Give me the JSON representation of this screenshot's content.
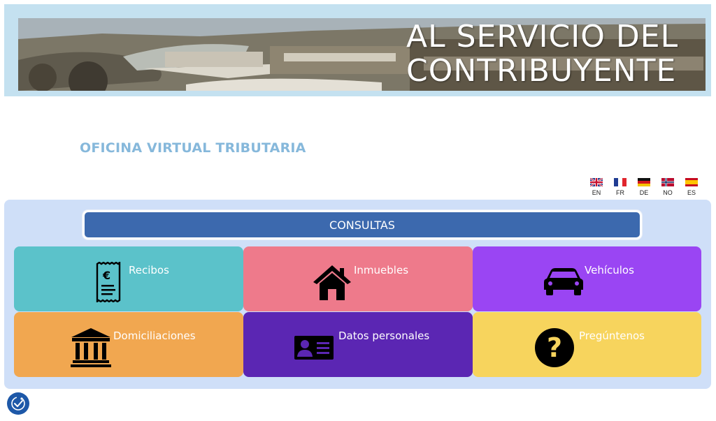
{
  "banner": {
    "title_line1": "AL SERVICIO DEL",
    "title_line2": "CONTRIBUYENTE"
  },
  "office_title": "OFICINA VIRTUAL TRIBUTARIA",
  "languages": [
    {
      "code": "EN",
      "icon": "uk-flag-icon"
    },
    {
      "code": "FR",
      "icon": "france-flag-icon"
    },
    {
      "code": "DE",
      "icon": "germany-flag-icon"
    },
    {
      "code": "NO",
      "icon": "norway-flag-icon"
    },
    {
      "code": "ES",
      "icon": "spain-flag-icon"
    }
  ],
  "panel": {
    "header": "CONSULTAS",
    "tiles": [
      {
        "label": "Recibos",
        "icon": "receipt-euro-icon",
        "color": "#5bc2ca"
      },
      {
        "label": "Inmuebles",
        "icon": "house-icon",
        "color": "#ee7a8b"
      },
      {
        "label": "Vehículos",
        "icon": "car-icon",
        "color": "#9a45f3"
      },
      {
        "label": "Domiciliaciones",
        "icon": "bank-icon",
        "color": "#f1a750"
      },
      {
        "label": "Datos personales",
        "icon": "id-card-icon",
        "color": "#5b26b3"
      },
      {
        "label": "Pregúntenos",
        "icon": "question-mark-icon",
        "color": "#f7d45d"
      }
    ]
  },
  "accessibility_button": {
    "icon": "accessibility-icon"
  },
  "colors": {
    "header_blue": "#3c69ae",
    "panel_bg": "#cfdff8",
    "title_blue": "#86b8db",
    "banner_frame": "#c4e1f0"
  }
}
